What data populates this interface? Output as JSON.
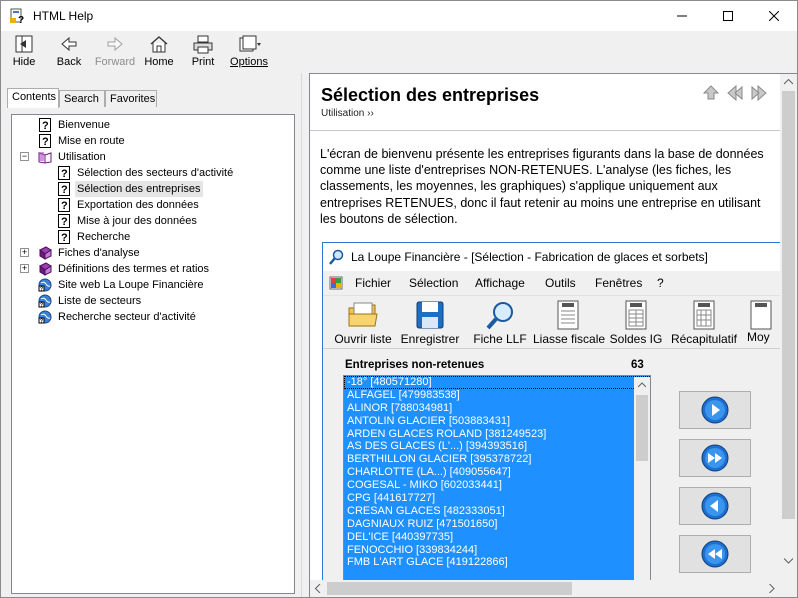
{
  "window": {
    "title": "HTML Help"
  },
  "toolbar": {
    "hide": "Hide",
    "back": "Back",
    "forward": "Forward",
    "home": "Home",
    "print": "Print",
    "options": "Options"
  },
  "tabs": {
    "contents": "Contents",
    "search": "Search",
    "favorites": "Favorites"
  },
  "tree": [
    {
      "label": "Bienvenue",
      "icon": "help-page-icon"
    },
    {
      "label": "Mise en route",
      "icon": "help-page-icon"
    },
    {
      "label": "Utilisation",
      "icon": "open-book-icon"
    },
    {
      "label": "Sélection des secteurs d'activité",
      "icon": "help-page-icon"
    },
    {
      "label": "Sélection des entreprises",
      "icon": "help-page-icon"
    },
    {
      "label": "Exportation des données",
      "icon": "help-page-icon"
    },
    {
      "label": "Mise à jour des données",
      "icon": "help-page-icon"
    },
    {
      "label": "Recherche",
      "icon": "help-page-icon"
    },
    {
      "label": "Fiches d'analyse",
      "icon": "closed-book-icon"
    },
    {
      "label": "Définitions des termes et ratios",
      "icon": "closed-book-icon"
    },
    {
      "label": "Site web La Loupe Financière",
      "icon": "web-link-icon"
    },
    {
      "label": "Liste de secteurs",
      "icon": "web-link-icon"
    },
    {
      "label": "Recherche secteur d'activité",
      "icon": "web-link-icon"
    }
  ],
  "topic": {
    "title": "Sélection des entreprises",
    "breadcrumb": "Utilisation ››",
    "body": "L'écran de bienvenu présente les entreprises figurants dans la base de données comme une liste d'entreprises NON-RETENUES. L'analyse (les fiches, les classements, les moyennes, les graphiques) s'applique uniquement aux entreprises RETENUES, donc il faut retenir au moins une entreprise en utilisant les boutons de sélection."
  },
  "embedded": {
    "title": "La Loupe Financière - [Sélection - Fabrication de glaces et sorbets]",
    "menu": [
      "Fichier",
      "Sélection",
      "Affichage",
      "Outils",
      "Fenêtres",
      "?"
    ],
    "tools": [
      "Ouvrir liste",
      "Enregistrer",
      "Fiche LLF",
      "Liasse fiscale",
      "Soldes IG",
      "Récapitulatif",
      "Moy"
    ],
    "list_header": "Entreprises non-retenues",
    "list_count": "63",
    "companies": [
      "-18° [480571280]",
      "ALFAGEL [479983538]",
      "ALINOR [788034981]",
      "ANTOLIN GLACIER [503883431]",
      "ARDEN GLACES ROLAND [381249523]",
      "AS DES GLACES (L'...) [394393516]",
      "BERTHILLON GLACIER [395378722]",
      "CHARLOTTE (LA...) [409055647]",
      "COGESAL - MIKO [602033441]",
      "CPG [441617727]",
      "CRESAN GLACES [482333051]",
      "DAGNIAUX RUIZ [471501650]",
      "DEL'ICE [440397735]",
      "FENOCCHIO [339834244]",
      "FMB L'ART GLACE [419122866]"
    ]
  },
  "colors": {
    "list_selection": "#1e90ff",
    "accent": "#0078d7"
  }
}
